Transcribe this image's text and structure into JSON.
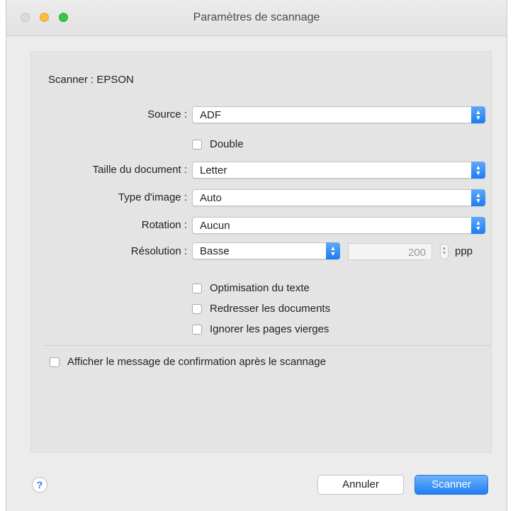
{
  "window": {
    "title": "Paramètres de scannage"
  },
  "scanner": {
    "label": "Scanner : EPSON"
  },
  "fields": {
    "source": {
      "label": "Source :",
      "value": "ADF"
    },
    "double": {
      "label": "Double",
      "checked": false
    },
    "doc_size": {
      "label": "Taille du document :",
      "value": "Letter"
    },
    "image_type": {
      "label": "Type d'image :",
      "value": "Auto"
    },
    "rotation": {
      "label": "Rotation :",
      "value": "Aucun"
    },
    "resolution": {
      "label": "Résolution :",
      "value": "Basse",
      "dpi": "200",
      "unit": "ppp"
    }
  },
  "options": [
    {
      "label": "Optimisation du texte",
      "checked": false
    },
    {
      "label": "Redresser les documents",
      "checked": false
    },
    {
      "label": "Ignorer les pages vierges",
      "checked": false
    }
  ],
  "confirm": {
    "label": "Afficher le message de confirmation après le scannage",
    "checked": false
  },
  "footer": {
    "help_symbol": "?",
    "cancel_label": "Annuler",
    "scan_label": "Scanner"
  },
  "colors": {
    "accent": "#1d7cf2"
  },
  "icons": {
    "popup_arrows": "updown-chevron-icon",
    "help": "help-icon"
  }
}
